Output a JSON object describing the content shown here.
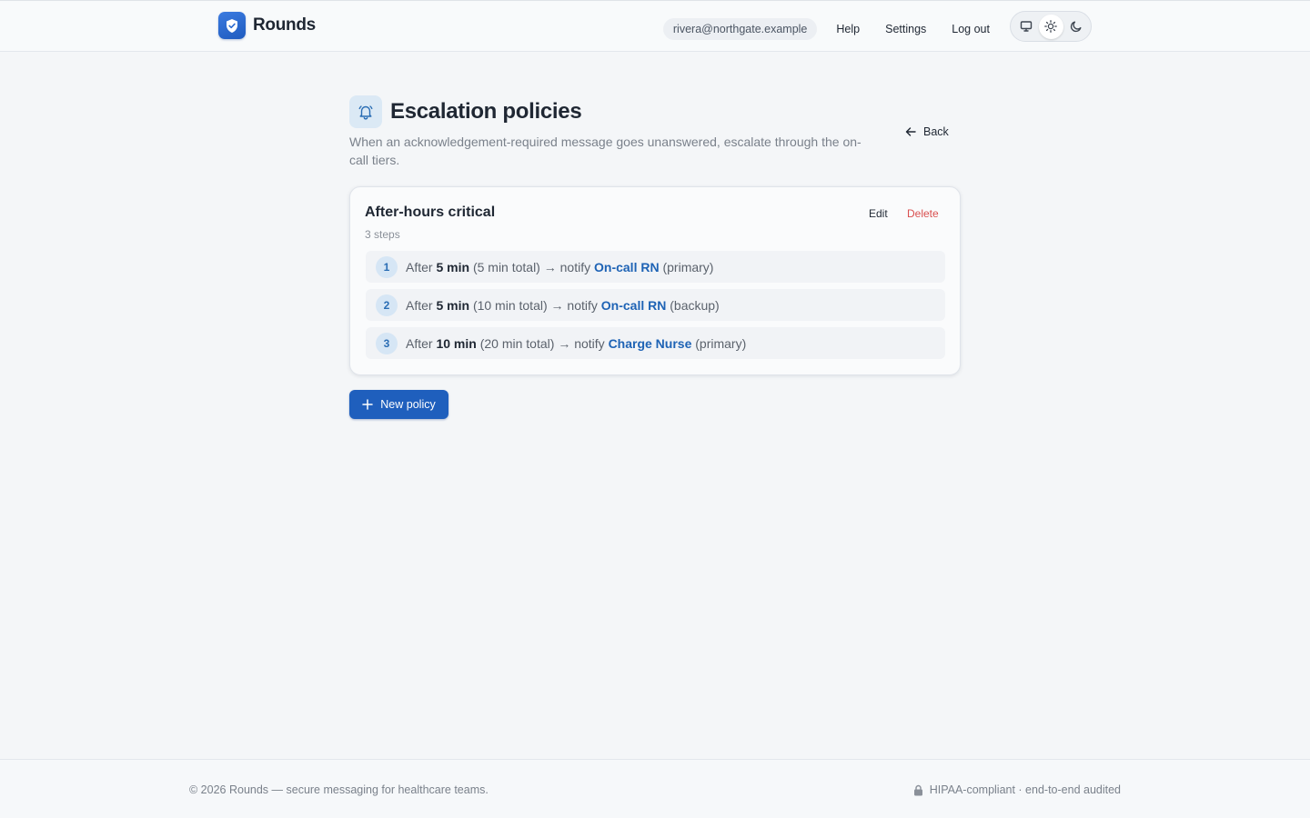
{
  "header": {
    "brand": "Rounds",
    "user_email": "rivera@northgate.example",
    "nav": {
      "help": "Help",
      "settings": "Settings",
      "logout": "Log out"
    },
    "theme_modes": [
      "monitor-icon",
      "sun-icon",
      "moon-icon"
    ],
    "active_theme": "light"
  },
  "page": {
    "title": "Escalation policies",
    "subtitle": "When an acknowledgement-required message goes unanswered, escalate through the on-call tiers.",
    "back_label": "Back"
  },
  "policy": {
    "name": "After-hours critical",
    "meta": "3 steps",
    "edit_label": "Edit",
    "delete_label": "Delete",
    "steps": [
      {
        "num": "1",
        "after_prefix": "After",
        "delay": "5 min",
        "total": "(5 min total)",
        "notify": "→ notify",
        "role": "On-call RN",
        "tier": "(primary)"
      },
      {
        "num": "2",
        "after_prefix": "After",
        "delay": "5 min",
        "total": "(10 min total)",
        "notify": "→ notify",
        "role": "On-call RN",
        "tier": "(backup)"
      },
      {
        "num": "3",
        "after_prefix": "After",
        "delay": "10 min",
        "total": "(20 min total)",
        "notify": "→ notify",
        "role": "Charge Nurse",
        "tier": "(primary)"
      }
    ]
  },
  "actions": {
    "new_policy": "New policy"
  },
  "footer": {
    "left": "© 2026 Rounds — secure messaging for healthcare teams.",
    "right": "HIPAA-compliant · end-to-end audited"
  },
  "colors": {
    "accent": "#1f5fbd",
    "link": "#1e63b5",
    "danger": "#d94f4f",
    "background": "#f4f6f8"
  }
}
